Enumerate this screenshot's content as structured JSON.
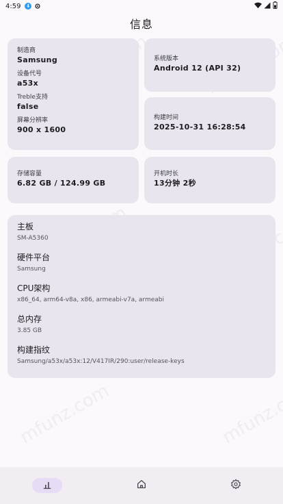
{
  "status_bar": {
    "time": "4:59"
  },
  "title": "信息",
  "device": {
    "manufacturer_label": "制造商",
    "manufacturer": "Samsung",
    "codename_label": "设备代号",
    "codename": "a53x",
    "treble_label": "Treble支持",
    "treble": "false",
    "resolution_label": "屏幕分辨率",
    "resolution": "900 x 1600"
  },
  "system": {
    "label": "系统版本",
    "value": "Android 12 (API 32)"
  },
  "build_time": {
    "label": "构建时间",
    "value": "2025-10-31 16:28:54"
  },
  "storage": {
    "label": "存储容量",
    "value": "6.82 GB / 124.99 GB"
  },
  "uptime": {
    "label": "开机时长",
    "value": "13分钟 2秒"
  },
  "details": [
    {
      "label": "主板",
      "value": "SM-A5360"
    },
    {
      "label": "硬件平台",
      "value": "Samsung"
    },
    {
      "label": "CPU架构",
      "value": "x86_64, arm64-v8a, x86, armeabi-v7a, armeabi"
    },
    {
      "label": "总内存",
      "value": "3.85 GB"
    },
    {
      "label": "构建指纹",
      "value": "Samsung/a53x/a53x:12/V417IR/290:user/release-keys"
    }
  ],
  "watermark": "mfunz.com",
  "nav": [
    {
      "icon": "bar-chart-icon",
      "active": true
    },
    {
      "icon": "home-icon",
      "active": false
    },
    {
      "icon": "gear-icon",
      "active": false
    }
  ]
}
